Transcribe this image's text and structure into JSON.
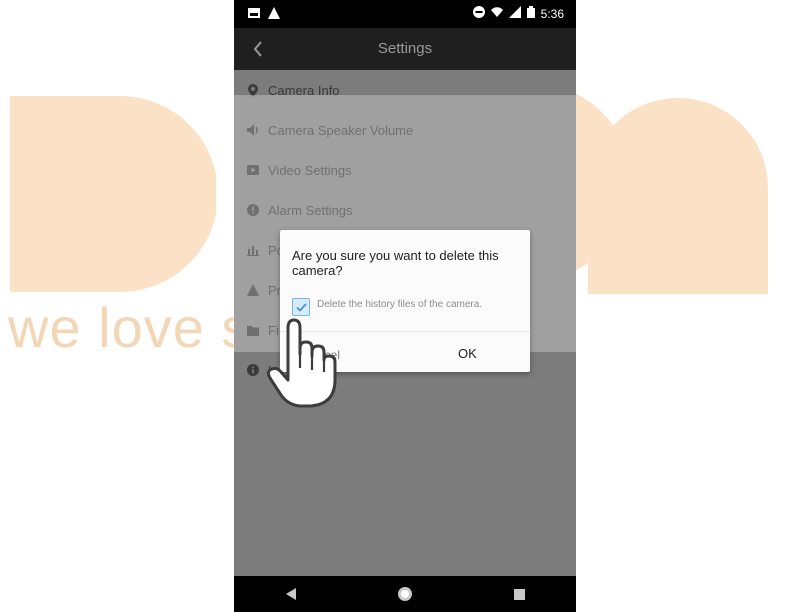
{
  "watermark": {
    "text": "we love smart"
  },
  "statusbar": {
    "time": "5:36"
  },
  "appbar": {
    "title": "Settings"
  },
  "settings_list": [
    {
      "label": "Camera Info",
      "icon": "location-pin-icon"
    },
    {
      "label": "Camera Speaker Volume",
      "icon": "speaker-volume-icon"
    },
    {
      "label": "Video Settings",
      "icon": "video-icon"
    },
    {
      "label": "Alarm Settings",
      "icon": "alarm-icon"
    },
    {
      "label": "Po",
      "icon": "bars-icon"
    },
    {
      "label": "Pr",
      "icon": "person-icon"
    },
    {
      "label": "Fi",
      "icon": "folder-icon"
    },
    {
      "label": "L",
      "icon": "info-icon"
    }
  ],
  "dialog": {
    "message": "Are you sure you want to delete this camera?",
    "checkbox_label": "Delete the history files of the camera.",
    "checkbox_checked": true,
    "cancel_label": "ncel",
    "ok_label": "OK"
  },
  "colors": {
    "watermark": "#f3d6b6",
    "checkbox_accent": "#4a90d9"
  }
}
